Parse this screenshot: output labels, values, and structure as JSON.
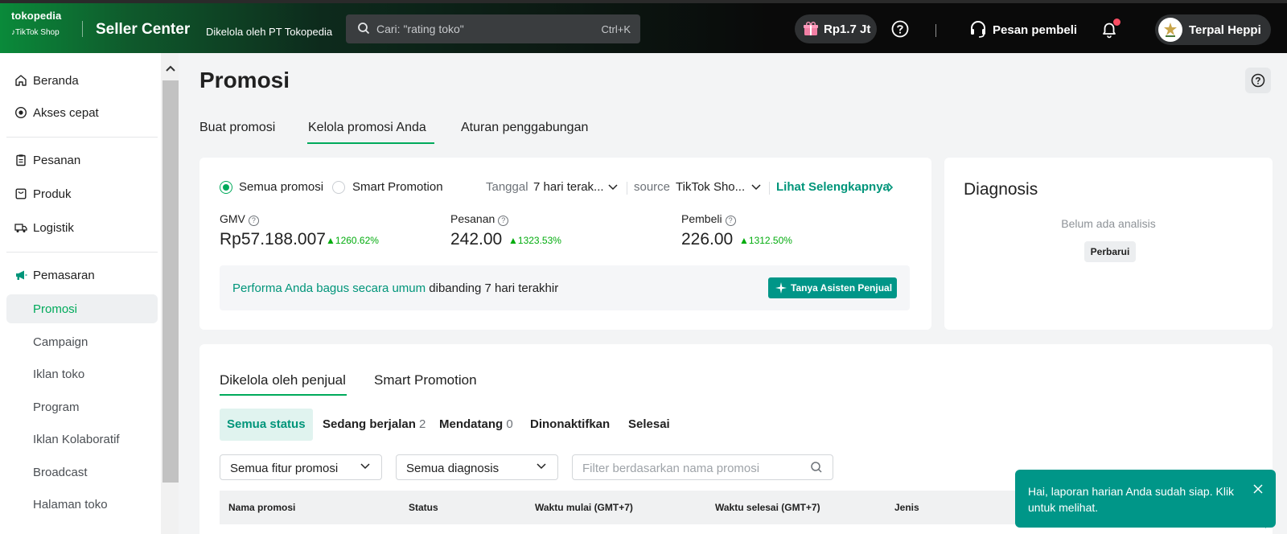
{
  "header": {
    "logo_tokopedia": "tokopedia",
    "logo_tiktok": "TikTok Shop",
    "title": "Seller Center",
    "managed_by": "Dikelola oleh PT Tokopedia",
    "search_placeholder": "Cari: \"rating toko\"",
    "search_shortcut": "Ctrl+K",
    "balance": "Rp1.7 Jt",
    "messages_label": "Pesan pembeli",
    "user_name": "Terpal Heppi"
  },
  "sidebar": {
    "items": [
      {
        "label": "Beranda",
        "icon": "home-icon"
      },
      {
        "label": "Akses cepat",
        "icon": "target-icon"
      },
      {
        "label": "Pesanan",
        "icon": "clipboard-icon"
      },
      {
        "label": "Produk",
        "icon": "box-icon"
      },
      {
        "label": "Logistik",
        "icon": "truck-icon"
      },
      {
        "label": "Pemasaran",
        "icon": "megaphone-icon"
      }
    ],
    "sub_items": [
      "Promosi",
      "Campaign",
      "Iklan toko",
      "Program",
      "Iklan Kolaboratif",
      "Broadcast",
      "Halaman toko"
    ]
  },
  "page": {
    "title": "Promosi",
    "tabs": [
      "Buat promosi",
      "Kelola promosi Anda",
      "Aturan penggabungan"
    ],
    "active_tab": "Kelola promosi Anda"
  },
  "summary": {
    "radio_all": "Semua promosi",
    "radio_smart": "Smart Promotion",
    "date_label": "Tanggal",
    "date_value": "7 hari terak...",
    "source_label": "source",
    "source_value": "TikTok Sho...",
    "more_link": "Lihat Selengkapnya",
    "metrics": [
      {
        "label": "GMV",
        "value": "Rp57.188.007",
        "change": "1260.62%"
      },
      {
        "label": "Pesanan",
        "value": "242.00",
        "change": "1323.53%"
      },
      {
        "label": "Pembeli",
        "value": "226.00",
        "change": "1312.50%"
      }
    ],
    "performance_highlight": "Performa Anda bagus secara umum",
    "performance_rest": " dibanding 7 hari terakhir",
    "ask_button": "Tanya Asisten Penjual"
  },
  "diagnosis": {
    "title": "Diagnosis",
    "empty": "Belum ada analisis",
    "refresh": "Perbarui"
  },
  "list": {
    "tabs": [
      "Dikelola oleh penjual",
      "Smart Promotion"
    ],
    "chips": [
      {
        "label": "Semua status",
        "count": ""
      },
      {
        "label": "Sedang berjalan",
        "count": "2"
      },
      {
        "label": "Mendatang",
        "count": "0"
      },
      {
        "label": "Dinonaktifkan",
        "count": ""
      },
      {
        "label": "Selesai",
        "count": ""
      }
    ],
    "filter_feature": "Semua fitur promosi",
    "filter_diagnosis": "Semua diagnosis",
    "filter_placeholder": "Filter berdasarkan nama promosi",
    "columns": [
      "Nama promosi",
      "Status",
      "Waktu mulai (GMT+7)",
      "Waktu selesai (GMT+7)",
      "Jenis"
    ]
  },
  "toast": {
    "text": "Hai, laporan harian Anda sudah siap. Klik untuk melihat."
  },
  "colors": {
    "accent": "#00aa5b",
    "teal": "#009688",
    "positive": "#03ac0e"
  }
}
